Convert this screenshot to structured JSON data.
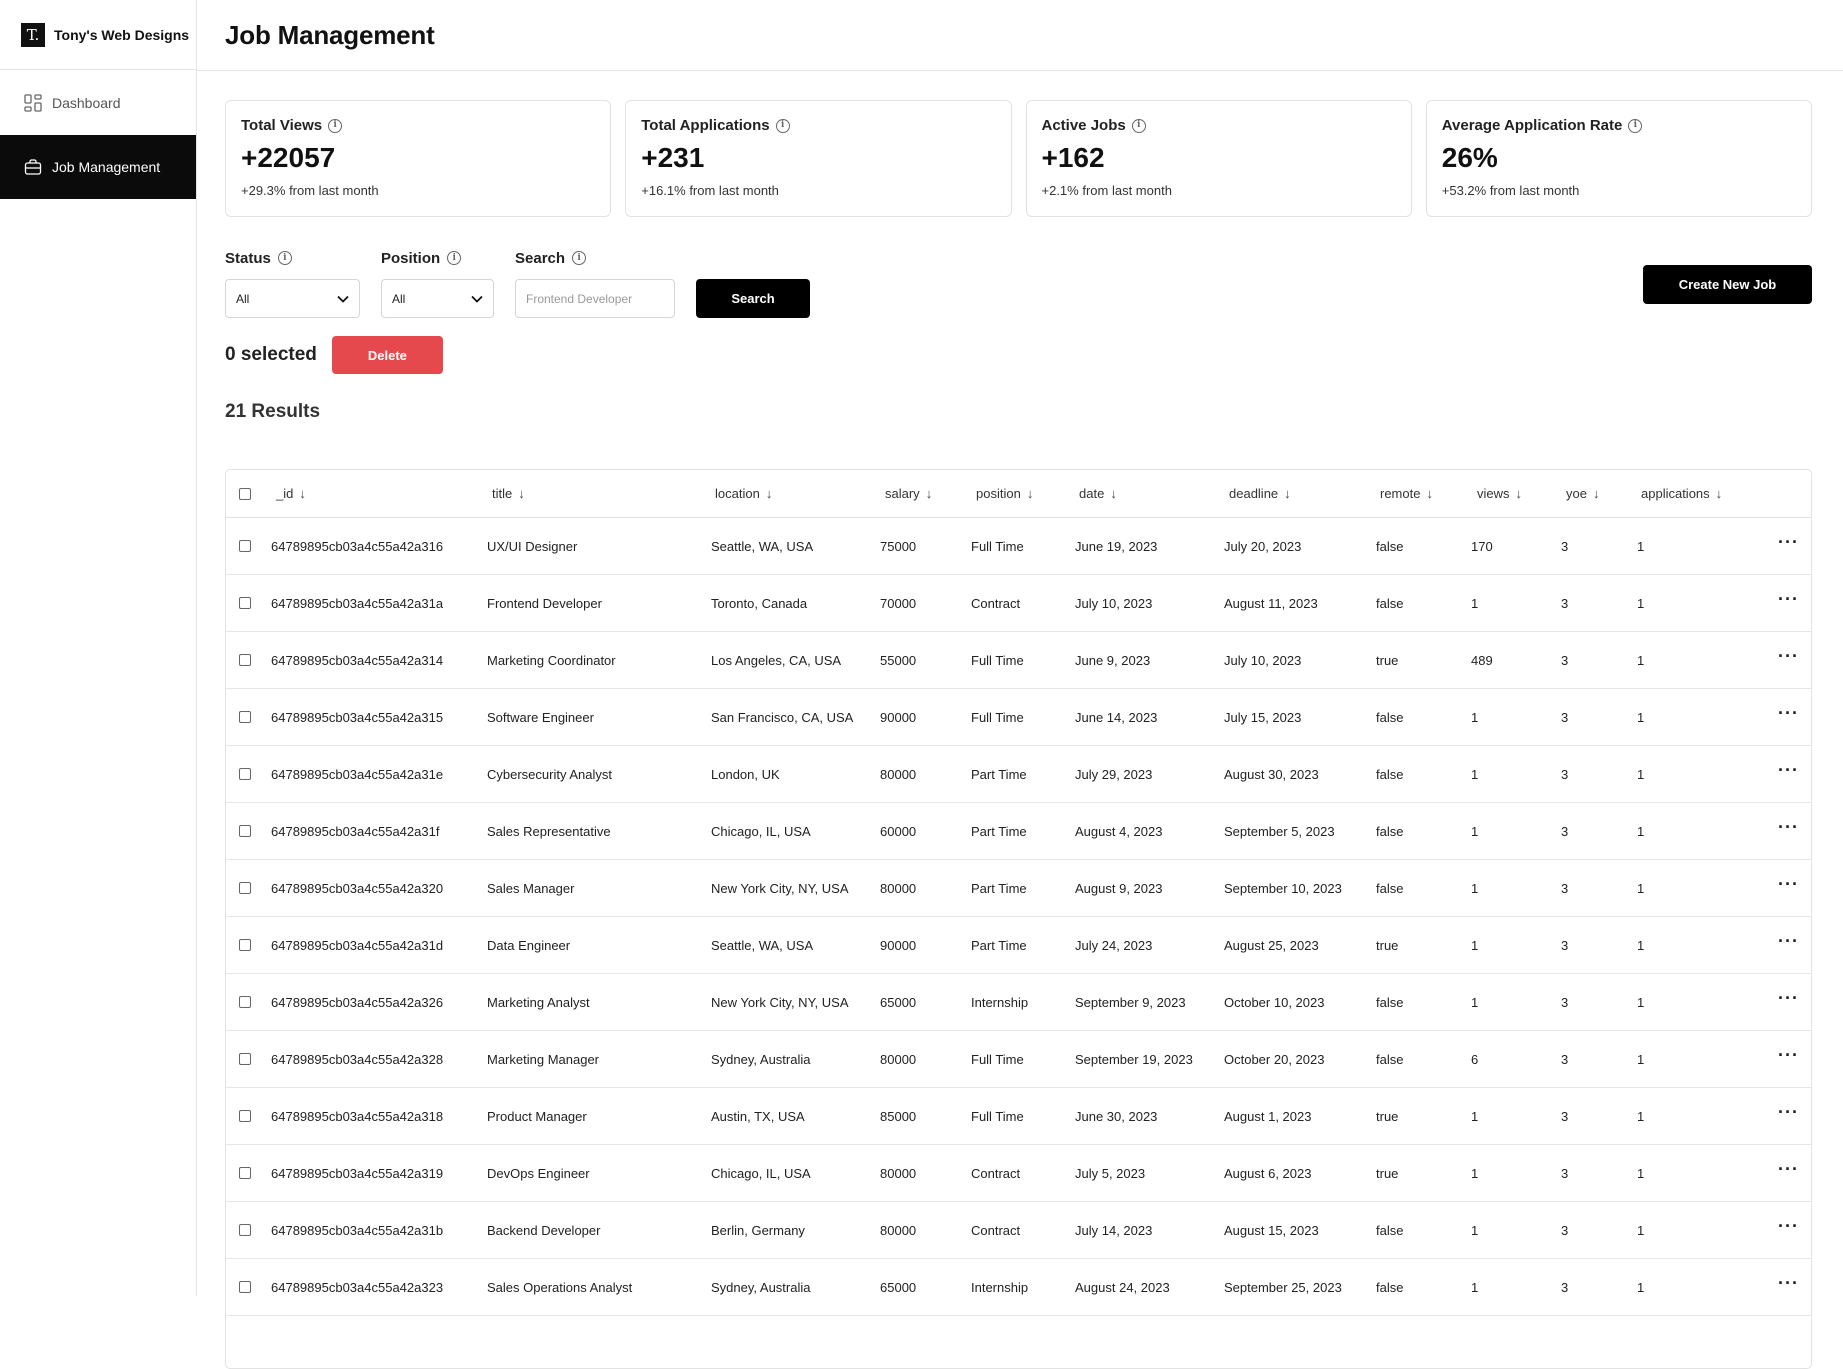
{
  "brand": {
    "logo_letter": "T.",
    "name": "Tony's Web Designs"
  },
  "nav": [
    {
      "label": "Dashboard",
      "icon": "dashboard-icon",
      "active": false
    },
    {
      "label": "Job Management",
      "icon": "briefcase-icon",
      "active": true
    }
  ],
  "header": {
    "title": "Job Management"
  },
  "stats": [
    {
      "label": "Total Views",
      "value": "+22057",
      "change": "+29.3% from last month"
    },
    {
      "label": "Total Applications",
      "value": "+231",
      "change": "+16.1% from last month"
    },
    {
      "label": "Active Jobs",
      "value": "+162",
      "change": "+2.1% from last month"
    },
    {
      "label": "Average Application Rate",
      "value": "26%",
      "change": "+53.2% from last month"
    }
  ],
  "filters": {
    "status": {
      "label": "Status",
      "value": "All"
    },
    "position": {
      "label": "Position",
      "value": "All"
    },
    "search": {
      "label": "Search",
      "placeholder": "Frontend Developer",
      "button": "Search"
    },
    "create_button": "Create New Job"
  },
  "selection": {
    "text": "0 selected",
    "delete_button": "Delete"
  },
  "results_text": "21 Results",
  "table": {
    "columns": [
      "_id",
      "title",
      "location",
      "salary",
      "position",
      "date",
      "deadline",
      "remote",
      "views",
      "yoe",
      "applications"
    ],
    "rows": [
      [
        "64789895cb03a4c55a42a316",
        "UX/UI Designer",
        "Seattle, WA, USA",
        "75000",
        "Full Time",
        "June 19, 2023",
        "July 20, 2023",
        "false",
        "170",
        "3",
        "1"
      ],
      [
        "64789895cb03a4c55a42a31a",
        "Frontend Developer",
        "Toronto, Canada",
        "70000",
        "Contract",
        "July 10, 2023",
        "August 11, 2023",
        "false",
        "1",
        "3",
        "1"
      ],
      [
        "64789895cb03a4c55a42a314",
        "Marketing Coordinator",
        "Los Angeles, CA, USA",
        "55000",
        "Full Time",
        "June 9, 2023",
        "July 10, 2023",
        "true",
        "489",
        "3",
        "1"
      ],
      [
        "64789895cb03a4c55a42a315",
        "Software Engineer",
        "San Francisco, CA, USA",
        "90000",
        "Full Time",
        "June 14, 2023",
        "July 15, 2023",
        "false",
        "1",
        "3",
        "1"
      ],
      [
        "64789895cb03a4c55a42a31e",
        "Cybersecurity Analyst",
        "London, UK",
        "80000",
        "Part Time",
        "July 29, 2023",
        "August 30, 2023",
        "false",
        "1",
        "3",
        "1"
      ],
      [
        "64789895cb03a4c55a42a31f",
        "Sales Representative",
        "Chicago, IL, USA",
        "60000",
        "Part Time",
        "August 4, 2023",
        "September 5, 2023",
        "false",
        "1",
        "3",
        "1"
      ],
      [
        "64789895cb03a4c55a42a320",
        "Sales Manager",
        "New York City, NY, USA",
        "80000",
        "Part Time",
        "August 9, 2023",
        "September 10, 2023",
        "false",
        "1",
        "3",
        "1"
      ],
      [
        "64789895cb03a4c55a42a31d",
        "Data Engineer",
        "Seattle, WA, USA",
        "90000",
        "Part Time",
        "July 24, 2023",
        "August 25, 2023",
        "true",
        "1",
        "3",
        "1"
      ],
      [
        "64789895cb03a4c55a42a326",
        "Marketing Analyst",
        "New York City, NY, USA",
        "65000",
        "Internship",
        "September 9, 2023",
        "October 10, 2023",
        "false",
        "1",
        "3",
        "1"
      ],
      [
        "64789895cb03a4c55a42a328",
        "Marketing Manager",
        "Sydney, Australia",
        "80000",
        "Full Time",
        "September 19, 2023",
        "October 20, 2023",
        "false",
        "6",
        "3",
        "1"
      ],
      [
        "64789895cb03a4c55a42a318",
        "Product Manager",
        "Austin, TX, USA",
        "85000",
        "Full Time",
        "June 30, 2023",
        "August 1, 2023",
        "true",
        "1",
        "3",
        "1"
      ],
      [
        "64789895cb03a4c55a42a319",
        "DevOps Engineer",
        "Chicago, IL, USA",
        "80000",
        "Contract",
        "July 5, 2023",
        "August 6, 2023",
        "true",
        "1",
        "3",
        "1"
      ],
      [
        "64789895cb03a4c55a42a31b",
        "Backend Developer",
        "Berlin, Germany",
        "80000",
        "Contract",
        "July 14, 2023",
        "August 15, 2023",
        "false",
        "1",
        "3",
        "1"
      ],
      [
        "64789895cb03a4c55a42a323",
        "Sales Operations Analyst",
        "Sydney, Australia",
        "65000",
        "Internship",
        "August 24, 2023",
        "September 25, 2023",
        "false",
        "1",
        "3",
        "1"
      ]
    ],
    "row_action_icon": "more-horizontal-icon",
    "sort_icon": "arrow-down-icon"
  },
  "colors": {
    "accent": "#000000",
    "danger": "#e5484d",
    "active_nav": "#0b0b0b",
    "border": "#e2e2e2"
  }
}
